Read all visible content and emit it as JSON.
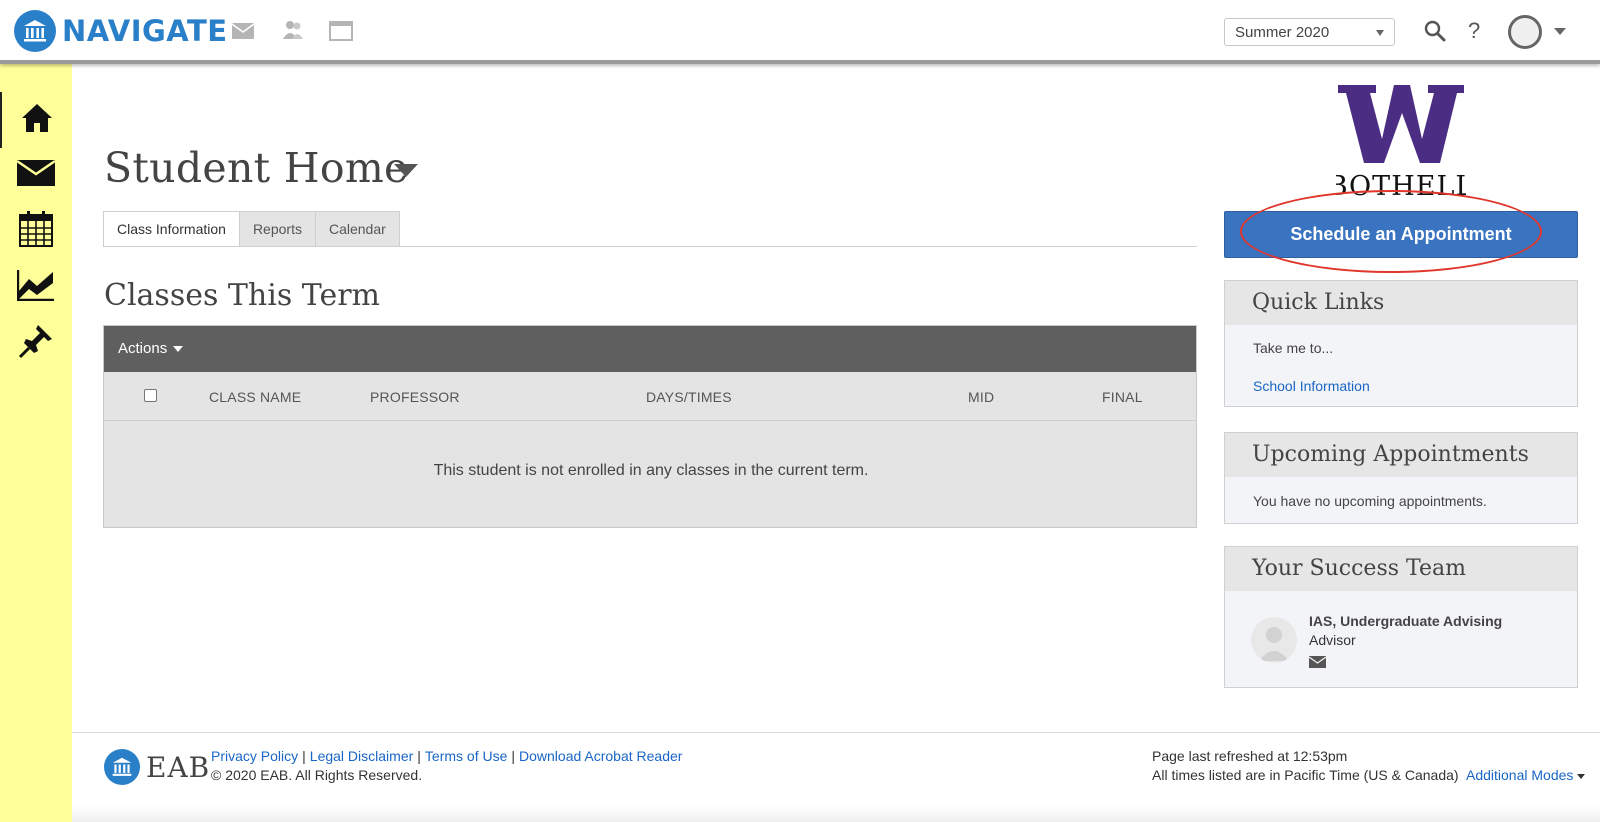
{
  "app": {
    "name": "NAVIGATE",
    "footer_brand": "EAB"
  },
  "colors": {
    "brand_blue": "#2a7fc9",
    "sidebar_yellow": "#ffff99",
    "button_blue": "#3a73c0",
    "annotation_red": "#e0362b",
    "link_blue": "#1a66c7"
  },
  "header": {
    "icons": [
      "mail-icon",
      "people-icon",
      "window-icon"
    ],
    "term_select": {
      "value": "Summer 2020"
    },
    "right_icons": [
      "search-icon",
      "help-icon",
      "avatar",
      "user-menu-caret"
    ],
    "help_glyph": "?"
  },
  "sidebar": {
    "items": [
      {
        "icon": "home-icon",
        "active": true
      },
      {
        "icon": "mail-icon",
        "active": false
      },
      {
        "icon": "calendar-icon",
        "active": false
      },
      {
        "icon": "chart-icon",
        "active": false
      },
      {
        "icon": "pin-icon",
        "active": false
      }
    ]
  },
  "main": {
    "page_title": "Student Home",
    "tabs": [
      {
        "label": "Class Information",
        "active": true
      },
      {
        "label": "Reports",
        "active": false
      },
      {
        "label": "Calendar",
        "active": false
      }
    ],
    "section_title": "Classes This Term",
    "actions_label": "Actions",
    "table": {
      "columns": [
        "CLASS NAME",
        "PROFESSOR",
        "DAYS/TIMES",
        "MID",
        "FINAL"
      ],
      "empty_message": "This student is not enrolled in any classes in the current term."
    }
  },
  "right": {
    "school_logo": {
      "letter": "W",
      "caption": "BOTHELL"
    },
    "appointment_button": "Schedule an Appointment",
    "quick_links": {
      "title": "Quick Links",
      "intro": "Take me to...",
      "links": [
        "School Information"
      ]
    },
    "upcoming": {
      "title": "Upcoming Appointments",
      "message": "You have no upcoming appointments."
    },
    "success_team": {
      "title": "Your Success Team",
      "members": [
        {
          "name": "IAS, Undergraduate Advising",
          "role": "Advisor"
        }
      ]
    }
  },
  "footer": {
    "links": [
      "Privacy Policy",
      "Legal Disclaimer",
      "Terms of Use",
      "Download Acrobat Reader"
    ],
    "separator": "|",
    "copyright": "© 2020 EAB. All Rights Reserved.",
    "refreshed": "Page last refreshed at 12:53pm",
    "timezone": "All times listed are in Pacific Time (US & Canada)",
    "modes_label": "Additional Modes"
  }
}
